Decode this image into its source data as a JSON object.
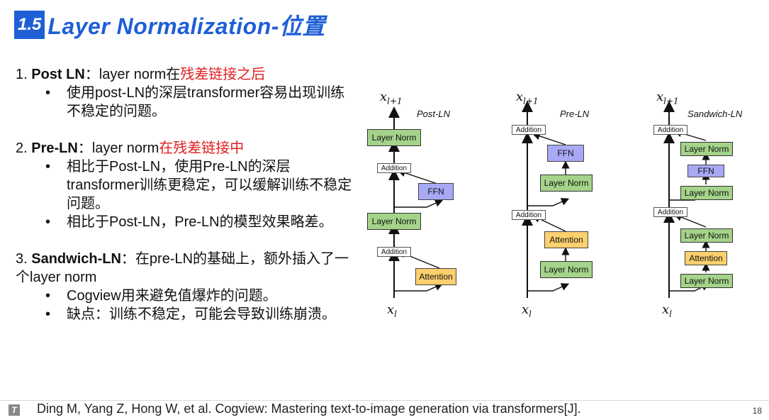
{
  "title": {
    "number": "1.5",
    "text": "Layer Normalization-位置"
  },
  "sections": [
    {
      "num": "1.",
      "name": "Post LN",
      "sep": "：layer norm在",
      "highlight": "残差链接之后",
      "tail": "",
      "bullets": [
        "使用post-LN的深层transformer容易出现训练不稳定的问题。"
      ]
    },
    {
      "num": "2.",
      "name": "Pre-LN",
      "sep": "：layer norm",
      "highlight": "在残差链接中",
      "tail": "",
      "bullets": [
        "相比于Post-LN，使用Pre-LN的深层transformer训练更稳定，可以缓解训练不稳定问题。",
        "相比于Post-LN，Pre-LN的模型效果略差。"
      ]
    },
    {
      "num": "3.",
      "name": "Sandwich-LN",
      "sep": "：在pre-LN的基础上，额外插入了一个layer norm",
      "highlight": "",
      "tail": "",
      "bullets": [
        "Cogview用来避免值爆炸的问题。",
        "缺点：训练不稳定，可能会导致训练崩溃。"
      ]
    }
  ],
  "diagram": {
    "post_ln": {
      "label": "Post-LN",
      "layer_norm": "Layer Norm",
      "addition": "Addition",
      "ffn": "FFN",
      "attention": "Attention"
    },
    "pre_ln": {
      "label": "Pre-LN",
      "layer_norm": "Layer Norm",
      "addition": "Addition",
      "ffn": "FFN",
      "attention": "Attention"
    },
    "sandwich_ln": {
      "label": "Sandwich-LN",
      "layer_norm": "Layer Norm",
      "addition": "Addition",
      "ffn": "FFN",
      "attention": "Attention"
    },
    "x_top": "x",
    "x_top_sub": "l+1",
    "x_bottom": "x",
    "x_bottom_sub": "l",
    "colors": {
      "layer_norm": "#a4d38a",
      "ffn": "#a8a9f5",
      "attention": "#fcd06e",
      "title_blue": "#1f5fd6",
      "highlight_red": "#e02020"
    }
  },
  "footer": {
    "icon": "footer-logo-icon",
    "citation": "Ding M, Yang Z, Hong W, et al. Cogview: Mastering text-to-image generation via transformers[J].",
    "page": "18"
  }
}
